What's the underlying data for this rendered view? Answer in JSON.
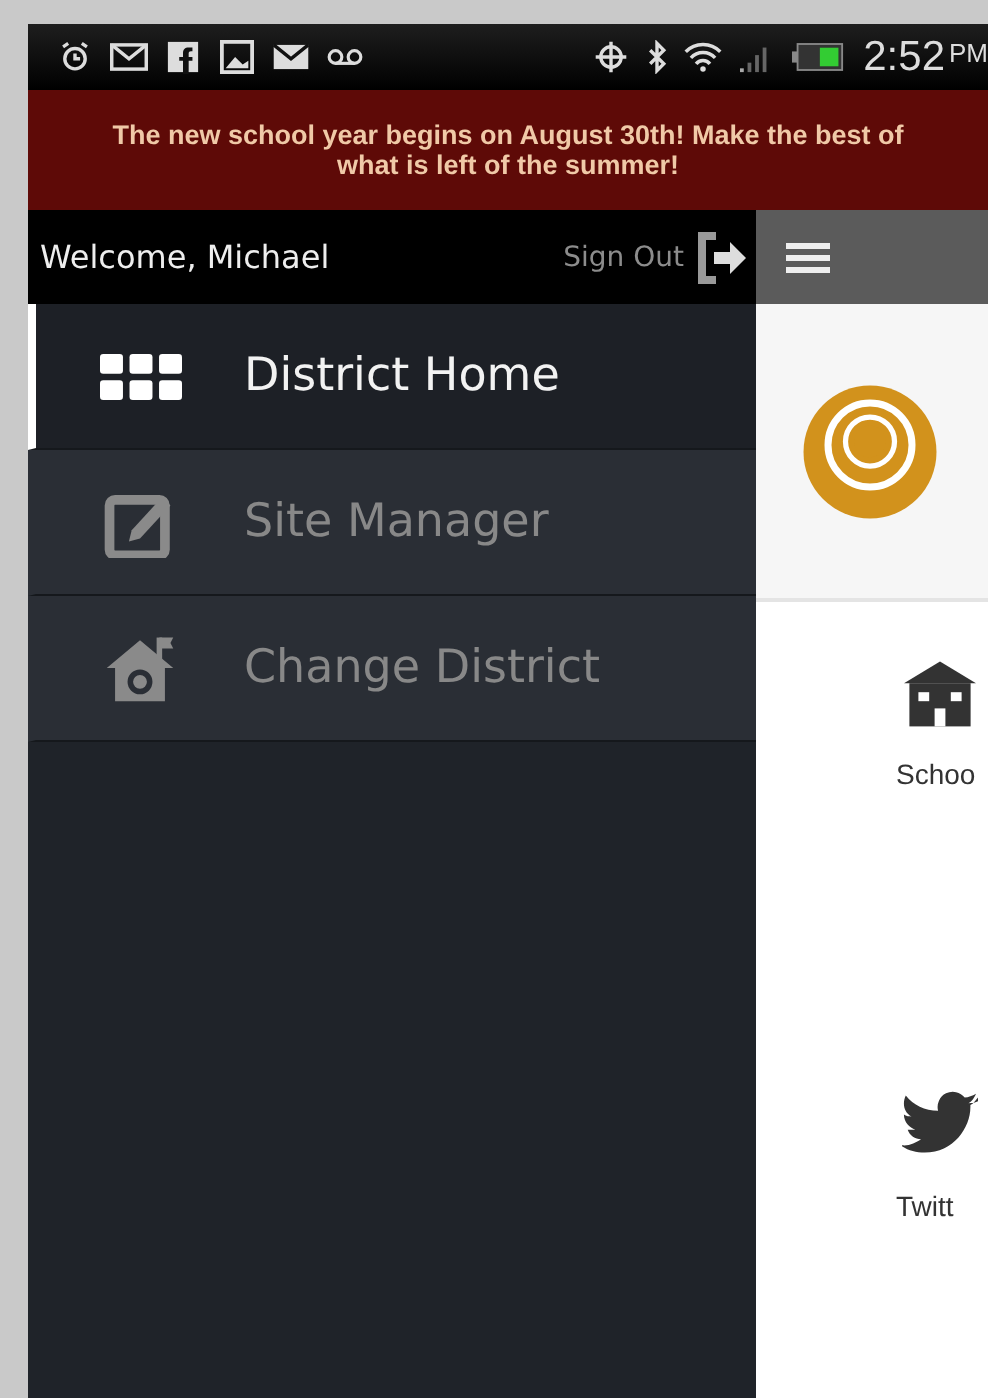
{
  "status_bar": {
    "time": "2:52",
    "meridiem": "PM"
  },
  "banner": {
    "text": "The new school year begins on August 30th! Make the best of what is left of the summer!"
  },
  "sidebar": {
    "welcome": "Welcome, Michael",
    "sign_out": "Sign Out",
    "items": [
      {
        "label": "District Home",
        "kind": "grid",
        "selected": true
      },
      {
        "label": "Site Manager",
        "kind": "edit",
        "selected": false
      },
      {
        "label": "Change District",
        "kind": "house",
        "selected": false
      }
    ]
  },
  "content": {
    "tiles": [
      {
        "label": "Schoo",
        "kind": "school"
      },
      {
        "label": "Twitt",
        "kind": "bird"
      }
    ]
  }
}
